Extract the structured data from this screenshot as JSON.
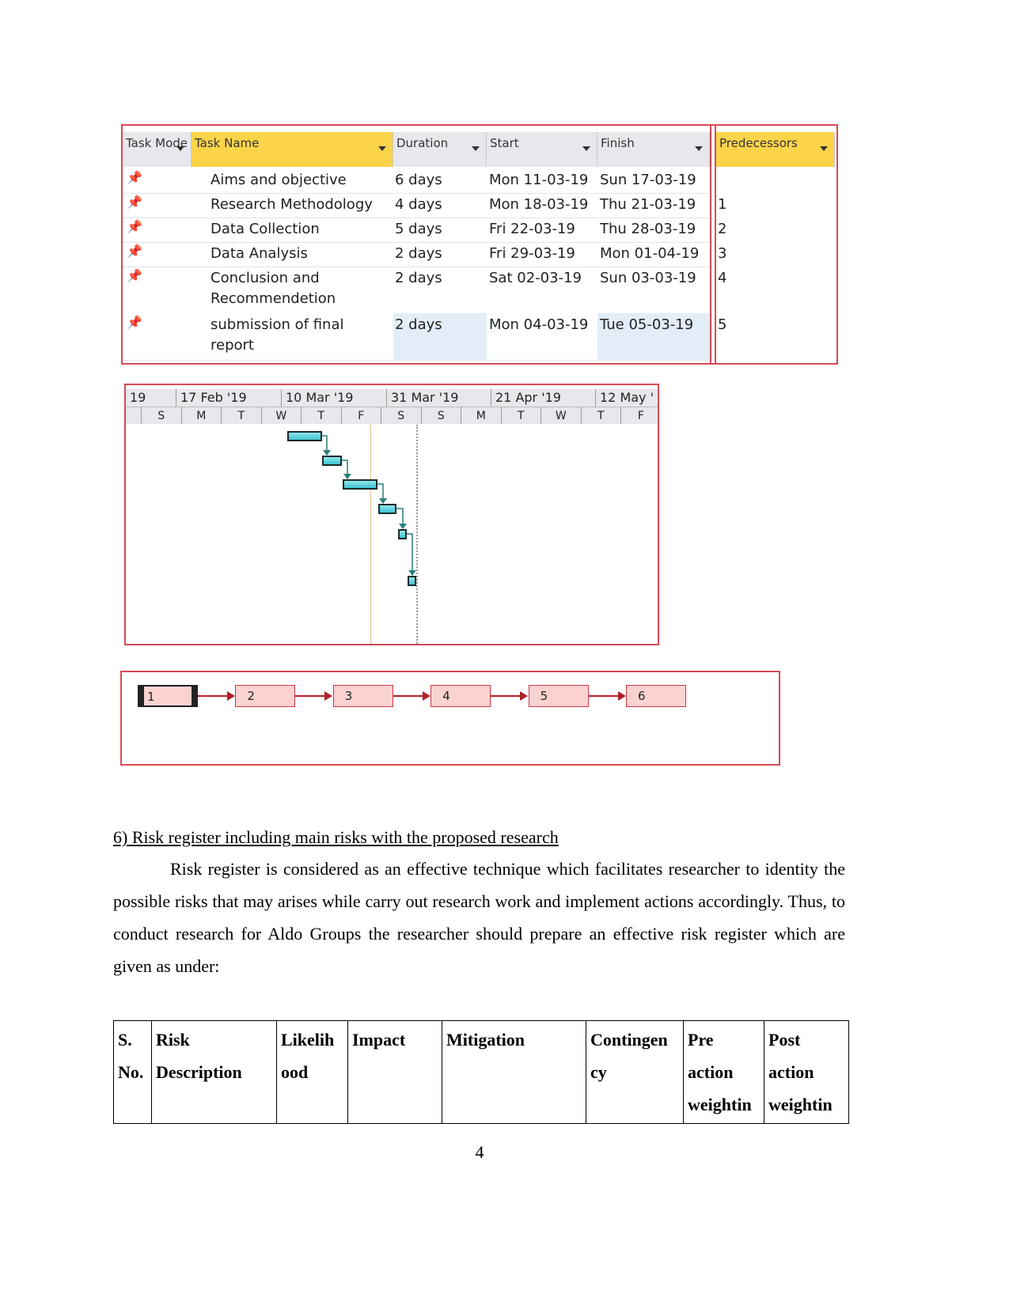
{
  "project_table": {
    "headers": {
      "task_mode": "Task Mode",
      "task_name": "Task Name",
      "duration": "Duration",
      "start": "Start",
      "finish": "Finish",
      "predecessors": "Predecessors"
    },
    "rows": [
      {
        "name": "Aims and objective",
        "duration": "6 days",
        "start": "Mon 11-03-19",
        "finish": "Sun 17-03-19",
        "pred": ""
      },
      {
        "name": "Research Methodology",
        "duration": "4 days",
        "start": "Mon 18-03-19",
        "finish": "Thu 21-03-19",
        "pred": "1"
      },
      {
        "name": "Data Collection",
        "duration": "5 days",
        "start": "Fri 22-03-19",
        "finish": "Thu 28-03-19",
        "pred": "2"
      },
      {
        "name": "Data Analysis",
        "duration": "2 days",
        "start": "Fri 29-03-19",
        "finish": "Mon 01-04-19",
        "pred": "3"
      },
      {
        "name": "Conclusion and Recommendetion",
        "duration": "2 days",
        "start": "Sat 02-03-19",
        "finish": "Sun 03-03-19",
        "pred": "4"
      },
      {
        "name": "submission of final report",
        "duration": "2 days",
        "start": "Mon 04-03-19",
        "finish": "Tue 05-03-19",
        "pred": "5"
      }
    ],
    "task_mode_icon": "pin-icon"
  },
  "gantt": {
    "timescale_top": [
      "19",
      "17 Feb '19",
      "10 Mar '19",
      "31 Mar '19",
      "21 Apr '19",
      "12 May '"
    ],
    "timescale_bottom": [
      "S",
      "M",
      "T",
      "W",
      "T",
      "F",
      "S",
      "S",
      "M",
      "T",
      "W",
      "T",
      "F"
    ],
    "bar_color": "#3fc4d0"
  },
  "network": {
    "nodes": [
      "1",
      "2",
      "3",
      "4",
      "5",
      "6"
    ],
    "node_color": "#fbd2d2",
    "border_color": "#c9343e"
  },
  "section": {
    "heading": "6) Risk register including main risks with the proposed research",
    "paragraph": "Risk register is considered as an effective technique which facilitates researcher to identity the possible risks that may arises while carry out research work and implement actions accordingly. Thus, to conduct research for Aldo Groups the researcher should prepare an effective risk register which are given as under:"
  },
  "risk_table": {
    "headers": [
      "S. No.",
      "Risk Description",
      "Likelih ood",
      "Impact",
      "Mitigation",
      "Contingen cy",
      "Pre action weightin",
      "Post action weightin"
    ]
  },
  "page_number": "4"
}
